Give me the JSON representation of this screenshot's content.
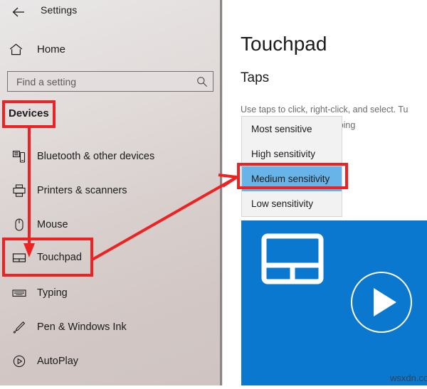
{
  "window": {
    "back_icon": "back-arrow-icon",
    "title": "Settings"
  },
  "sidebar": {
    "home": {
      "label": "Home",
      "icon": "home-icon"
    },
    "search": {
      "value": "",
      "placeholder": "Find a setting",
      "icon": "search-icon"
    },
    "category_heading": "Devices",
    "items": [
      {
        "label": "Bluetooth & other devices",
        "icon": "bluetooth-devices-icon",
        "selected": false
      },
      {
        "label": "Printers & scanners",
        "icon": "printer-icon",
        "selected": false
      },
      {
        "label": "Mouse",
        "icon": "mouse-icon",
        "selected": false
      },
      {
        "label": "Touchpad",
        "icon": "touchpad-icon",
        "selected": true
      },
      {
        "label": "Typing",
        "icon": "keyboard-icon",
        "selected": false
      },
      {
        "label": "Pen & Windows Ink",
        "icon": "pen-icon",
        "selected": false
      },
      {
        "label": "AutoPlay",
        "icon": "autoplay-icon",
        "selected": false
      }
    ]
  },
  "content": {
    "page_title": "Touchpad",
    "section_title": "Taps",
    "description_line1": "Use taps to click, right-click, and select. Tu",
    "description_line2": "'re typing",
    "dropdown": {
      "selected": "Medium sensitivity",
      "options": [
        {
          "label": "Most sensitive",
          "selected": false
        },
        {
          "label": "High sensitivity",
          "selected": false
        },
        {
          "label": "Medium sensitivity",
          "selected": true
        },
        {
          "label": "Low sensitivity",
          "selected": false
        }
      ]
    },
    "media": {
      "touchpad_glyph": "touchpad-illustration-icon",
      "play_icon": "play-button-icon",
      "watermark": "wsxdn.com",
      "background_color": "#0b78d0"
    }
  },
  "annotations": {
    "highlight_color": "#ee2222",
    "boxes": [
      {
        "target": "Devices"
      },
      {
        "target": "Touchpad"
      },
      {
        "target": "Medium sensitivity"
      }
    ],
    "arrows": [
      {
        "from": "Devices",
        "to": "Touchpad"
      },
      {
        "from": "Touchpad",
        "to": "Medium sensitivity"
      }
    ]
  }
}
